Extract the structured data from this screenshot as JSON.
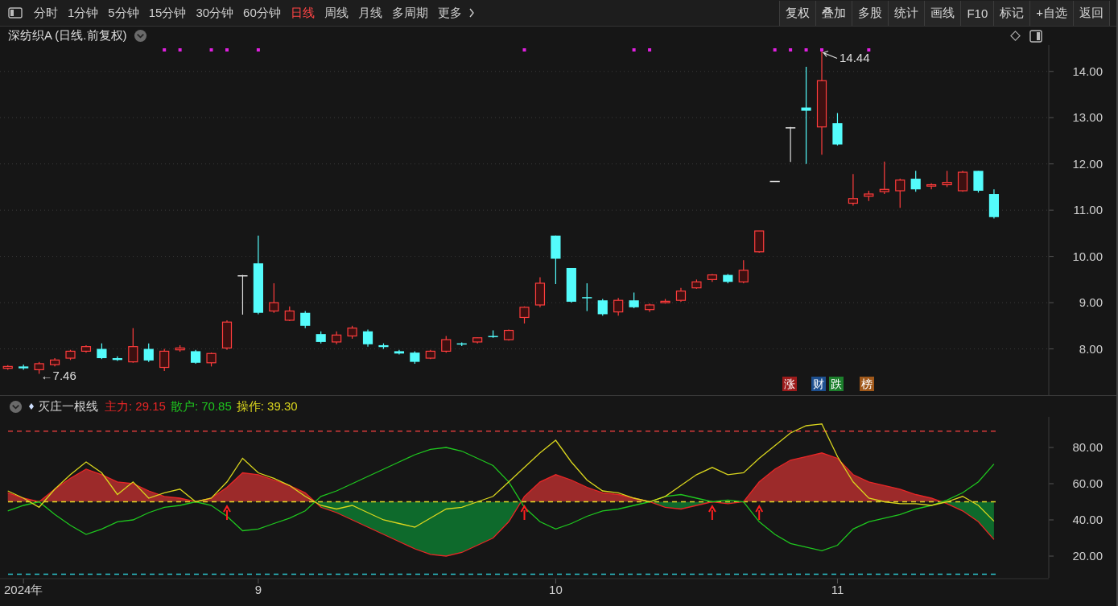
{
  "toolbar": {
    "periods": [
      {
        "label": "分时",
        "selected": false
      },
      {
        "label": "1分钟",
        "selected": false
      },
      {
        "label": "5分钟",
        "selected": false
      },
      {
        "label": "15分钟",
        "selected": false
      },
      {
        "label": "30分钟",
        "selected": false
      },
      {
        "label": "60分钟",
        "selected": false
      },
      {
        "label": "日线",
        "selected": true
      },
      {
        "label": "周线",
        "selected": false
      },
      {
        "label": "月线",
        "selected": false
      },
      {
        "label": "多周期",
        "selected": false
      },
      {
        "label": "更多",
        "selected": false
      }
    ],
    "buttons": [
      "复权",
      "叠加",
      "多股",
      "统计",
      "画线",
      "F10",
      "标记",
      "+自选",
      "返回"
    ]
  },
  "price_chart": {
    "title": "深纺织A (日线.前复权)",
    "chart_data": {
      "type": "candlestick",
      "grid": true,
      "ylim": [
        7.0,
        14.57
      ],
      "yticks": [
        {
          "value": 8,
          "label": "8.00"
        },
        {
          "value": 9,
          "label": "9.00"
        },
        {
          "value": 10,
          "label": "10.00"
        },
        {
          "value": 11,
          "label": "11.00"
        },
        {
          "value": 12,
          "label": "12.00"
        },
        {
          "value": 13,
          "label": "13.00"
        },
        {
          "value": 14,
          "label": "14.00"
        }
      ],
      "categories": [
        null,
        null,
        null,
        null,
        null,
        null,
        null,
        null,
        null,
        null,
        null,
        null,
        null,
        null,
        null,
        null,
        null,
        null,
        null,
        null,
        null,
        null,
        null,
        null,
        null,
        null,
        null,
        null,
        null,
        null,
        null,
        null,
        null,
        null,
        null,
        null,
        null,
        null,
        null,
        null,
        null,
        null,
        null,
        null,
        null,
        null,
        null,
        null,
        null,
        null,
        null,
        null,
        null,
        null,
        null,
        null,
        null,
        null,
        null,
        null,
        null,
        null,
        null,
        null,
        null,
        null,
        null
      ],
      "ohlc": [
        [
          7.58,
          7.65,
          7.55,
          7.62
        ],
        [
          7.62,
          7.66,
          7.55,
          7.58
        ],
        [
          7.55,
          7.72,
          7.46,
          7.68
        ],
        [
          7.66,
          7.8,
          7.62,
          7.76
        ],
        [
          7.8,
          7.98,
          7.76,
          7.95
        ],
        [
          7.95,
          8.08,
          7.92,
          8.05
        ],
        [
          8.0,
          8.12,
          7.78,
          7.8
        ],
        [
          7.8,
          7.84,
          7.74,
          7.76
        ],
        [
          7.72,
          8.45,
          7.7,
          8.05
        ],
        [
          8.0,
          8.12,
          7.72,
          7.75
        ],
        [
          7.6,
          8.0,
          7.52,
          7.95
        ],
        [
          7.98,
          8.08,
          7.94,
          8.02
        ],
        [
          7.95,
          7.98,
          7.68,
          7.7
        ],
        [
          7.7,
          7.92,
          7.62,
          7.9
        ],
        [
          8.02,
          8.62,
          7.98,
          8.58
        ],
        [
          9.58,
          9.6,
          8.75,
          9.58
        ],
        [
          9.85,
          10.45,
          8.75,
          8.78
        ],
        [
          8.82,
          9.42,
          8.78,
          9.0
        ],
        [
          8.62,
          8.92,
          8.6,
          8.82
        ],
        [
          8.78,
          8.82,
          8.45,
          8.5
        ],
        [
          8.32,
          8.38,
          8.12,
          8.15
        ],
        [
          8.15,
          8.38,
          8.1,
          8.3
        ],
        [
          8.28,
          8.5,
          8.22,
          8.45
        ],
        [
          8.38,
          8.42,
          8.05,
          8.1
        ],
        [
          8.08,
          8.12,
          8.0,
          8.04
        ],
        [
          7.95,
          7.98,
          7.88,
          7.9
        ],
        [
          7.92,
          7.95,
          7.68,
          7.72
        ],
        [
          7.8,
          7.98,
          7.78,
          7.95
        ],
        [
          7.95,
          8.28,
          7.92,
          8.2
        ],
        [
          8.12,
          8.14,
          8.06,
          8.1
        ],
        [
          8.15,
          8.25,
          8.12,
          8.24
        ],
        [
          8.28,
          8.4,
          8.24,
          8.26
        ],
        [
          8.2,
          8.42,
          8.18,
          8.4
        ],
        [
          8.68,
          8.92,
          8.55,
          8.9
        ],
        [
          8.95,
          9.55,
          8.9,
          9.42
        ],
        [
          10.45,
          10.45,
          9.4,
          9.95
        ],
        [
          9.75,
          9.75,
          9.0,
          9.02
        ],
        [
          9.12,
          9.42,
          8.82,
          9.1
        ],
        [
          9.05,
          9.08,
          8.72,
          8.75
        ],
        [
          8.8,
          9.1,
          8.72,
          9.05
        ],
        [
          9.05,
          9.22,
          8.88,
          8.9
        ],
        [
          8.85,
          8.98,
          8.8,
          8.95
        ],
        [
          9.0,
          9.08,
          8.98,
          9.03
        ],
        [
          9.05,
          9.32,
          9.02,
          9.25
        ],
        [
          9.32,
          9.5,
          9.3,
          9.45
        ],
        [
          9.5,
          9.62,
          9.45,
          9.6
        ],
        [
          9.6,
          9.62,
          9.42,
          9.45
        ],
        [
          9.45,
          9.92,
          9.42,
          9.7
        ],
        [
          10.1,
          10.55,
          10.08,
          10.55
        ],
        [
          11.62,
          11.62,
          11.62,
          11.62
        ],
        [
          12.78,
          12.8,
          12.05,
          12.78
        ],
        [
          13.22,
          14.1,
          12.0,
          13.15
        ],
        [
          12.8,
          14.44,
          12.2,
          13.8
        ],
        [
          12.88,
          13.1,
          12.4,
          12.42
        ],
        [
          11.15,
          11.78,
          11.1,
          11.25
        ],
        [
          11.3,
          11.42,
          11.2,
          11.35
        ],
        [
          11.4,
          12.05,
          11.35,
          11.45
        ],
        [
          11.42,
          11.68,
          11.05,
          11.65
        ],
        [
          11.68,
          11.85,
          11.4,
          11.45
        ],
        [
          11.52,
          11.58,
          11.45,
          11.55
        ],
        [
          11.55,
          11.85,
          11.5,
          11.6
        ],
        [
          11.42,
          11.85,
          11.4,
          11.82
        ],
        [
          11.85,
          11.85,
          11.38,
          11.42
        ],
        [
          11.35,
          11.45,
          10.82,
          10.85
        ],
        null,
        null,
        null
      ],
      "annotations": [
        {
          "text": "14.44"
        },
        {
          "text": "←7.46"
        }
      ]
    },
    "top_marks": [
      false,
      false,
      false,
      false,
      false,
      false,
      false,
      false,
      false,
      false,
      true,
      true,
      false,
      true,
      true,
      false,
      true,
      false,
      false,
      false,
      false,
      false,
      false,
      false,
      false,
      false,
      false,
      false,
      false,
      false,
      false,
      false,
      false,
      true,
      false,
      false,
      false,
      false,
      false,
      false,
      true,
      true,
      false,
      false,
      false,
      false,
      false,
      false,
      false,
      true,
      true,
      true,
      true,
      false,
      false,
      true,
      false,
      false,
      false,
      false,
      false,
      false,
      false,
      false
    ],
    "tags": [
      {
        "label": "涨",
        "color": "#9c1b1b"
      },
      {
        "label": "财",
        "color": "#1d4f8f"
      },
      {
        "label": "跌",
        "color": "#1c7f2c"
      },
      {
        "label": "榜",
        "color": "#a0581a"
      }
    ]
  },
  "indicator": {
    "name": "灭庄一根线",
    "readouts": [
      {
        "value": ": 29.15"
      },
      {
        "value": ": 70.85"
      },
      {
        "value": ": 39.30"
      }
    ],
    "chart_data": {
      "type": "line",
      "ylim": [
        8,
        96.9
      ],
      "yticks": [
        {
          "value": 20,
          "label": "20.00"
        },
        {
          "value": 40,
          "label": "40.00"
        },
        {
          "value": 60,
          "label": "60.00"
        },
        {
          "value": 80,
          "label": "80.00"
        }
      ],
      "categories": [
        null,
        "2024年",
        null,
        null,
        null,
        null,
        null,
        null,
        null,
        null,
        null,
        null,
        null,
        null,
        null,
        null,
        "9",
        null,
        null,
        null,
        null,
        null,
        null,
        null,
        null,
        null,
        null,
        null,
        null,
        null,
        null,
        null,
        null,
        null,
        null,
        "10",
        null,
        null,
        null,
        null,
        null,
        null,
        null,
        null,
        null,
        null,
        null,
        null,
        null,
        null,
        null,
        null,
        null,
        "11",
        null,
        null,
        null,
        null,
        null,
        null,
        null,
        null,
        null,
        null,
        null,
        null,
        null
      ],
      "series": [
        {
          "name": "主力",
          "color": "#e82626",
          "values": [
            55,
            52,
            50,
            57,
            63,
            68,
            65,
            61,
            60,
            56,
            53,
            52,
            50,
            52,
            58,
            66,
            65,
            62,
            59,
            55,
            47,
            44,
            40,
            36,
            32,
            28,
            24,
            21,
            20,
            22,
            26,
            30,
            39,
            53,
            61,
            65,
            62,
            58,
            55,
            54,
            52,
            50,
            47,
            46,
            48,
            50,
            49,
            50,
            61,
            68,
            73,
            75,
            77,
            74,
            65,
            61,
            59,
            57,
            54,
            52,
            49,
            45,
            39,
            29.15,
            null,
            null,
            null
          ]
        },
        {
          "name": "散户",
          "color": "#1fc71f",
          "values": [
            45,
            48,
            50,
            43,
            37,
            32,
            35,
            39,
            40,
            44,
            47,
            48,
            50,
            48,
            42,
            34,
            35,
            38,
            41,
            45,
            53,
            56,
            60,
            64,
            68,
            72,
            76,
            79,
            80,
            78,
            74,
            70,
            61,
            47,
            39,
            35,
            38,
            42,
            45,
            46,
            48,
            50,
            53,
            54,
            52,
            50,
            51,
            50,
            39,
            32,
            27,
            25,
            23,
            26,
            35,
            39,
            41,
            43,
            46,
            48,
            51,
            55,
            61,
            70.85,
            null,
            null,
            null
          ]
        },
        {
          "name": "操作",
          "color": "#d9d51e",
          "values": [
            56,
            52,
            47,
            57,
            65,
            72,
            66,
            54,
            61,
            52,
            55,
            57,
            50,
            52,
            61,
            74,
            66,
            63,
            59,
            53,
            48,
            46,
            48,
            44,
            40,
            38,
            36,
            41,
            46,
            47,
            50,
            53,
            61,
            69,
            77,
            84,
            72,
            62,
            56,
            55,
            52,
            50,
            53,
            59,
            65,
            69,
            65,
            66,
            74,
            81,
            88,
            92,
            93,
            75,
            61,
            52,
            50,
            49,
            49,
            48,
            50,
            53,
            48,
            39.3,
            null,
            null,
            null
          ]
        }
      ],
      "ref_lines": [
        {
          "axis": "y",
          "value": 89,
          "color": "#d83a3a"
        },
        {
          "axis": "y",
          "value": 50,
          "color": "#e0dc28"
        },
        {
          "axis": "y",
          "value": 10,
          "color": "#2cc4cc"
        }
      ]
    },
    "buy_arrows": [
      false,
      false,
      false,
      false,
      false,
      false,
      false,
      false,
      false,
      false,
      false,
      false,
      false,
      false,
      true,
      false,
      false,
      false,
      false,
      false,
      false,
      false,
      false,
      false,
      false,
      false,
      false,
      false,
      false,
      false,
      false,
      false,
      false,
      true,
      false,
      false,
      false,
      false,
      false,
      false,
      false,
      false,
      false,
      false,
      false,
      true,
      false,
      false,
      true,
      false,
      false,
      false,
      false,
      false,
      false,
      false,
      false,
      false,
      false,
      false,
      false,
      false,
      false,
      false
    ]
  }
}
